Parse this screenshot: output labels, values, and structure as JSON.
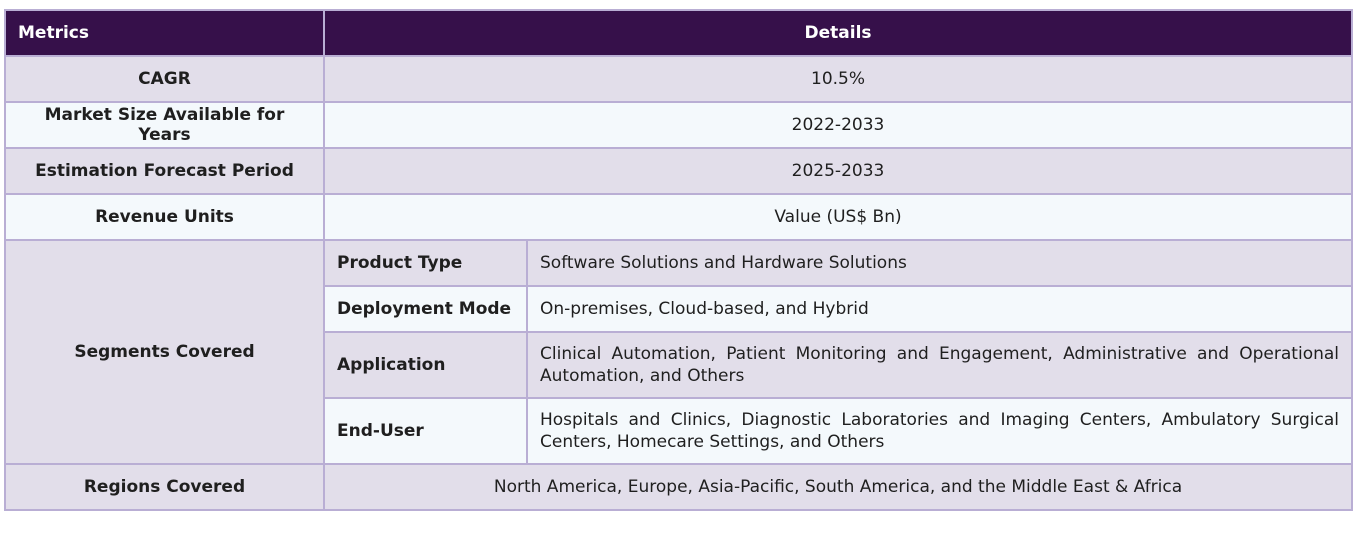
{
  "header": {
    "metrics": "Metrics",
    "details": "Details"
  },
  "rows": [
    {
      "label": "CAGR",
      "value": "10.5%"
    },
    {
      "label": "Market Size Available for Years",
      "value": "2022-2033"
    },
    {
      "label": "Estimation Forecast Period",
      "value": "2025-2033"
    },
    {
      "label": "Revenue Units",
      "value": "Value (US$ Bn)"
    }
  ],
  "segments": {
    "label": "Segments Covered",
    "items": [
      {
        "name": "Product Type",
        "detail": "Software Solutions and Hardware Solutions"
      },
      {
        "name": "Deployment Mode",
        "detail": "On-premises, Cloud-based, and Hybrid"
      },
      {
        "name": "Application",
        "detail": "Clinical Automation, Patient Monitoring and Engagement, Administrative and Operational Automation, and Others"
      },
      {
        "name": "End-User",
        "detail": "Hospitals and Clinics, Diagnostic Laboratories and Imaging Centers, Ambulatory Surgical Centers, Homecare Settings, and Others"
      }
    ]
  },
  "regions": {
    "label": "Regions Covered",
    "value": "North America, Europe, Asia-Pacific, South America, and the Middle East & Africa"
  }
}
